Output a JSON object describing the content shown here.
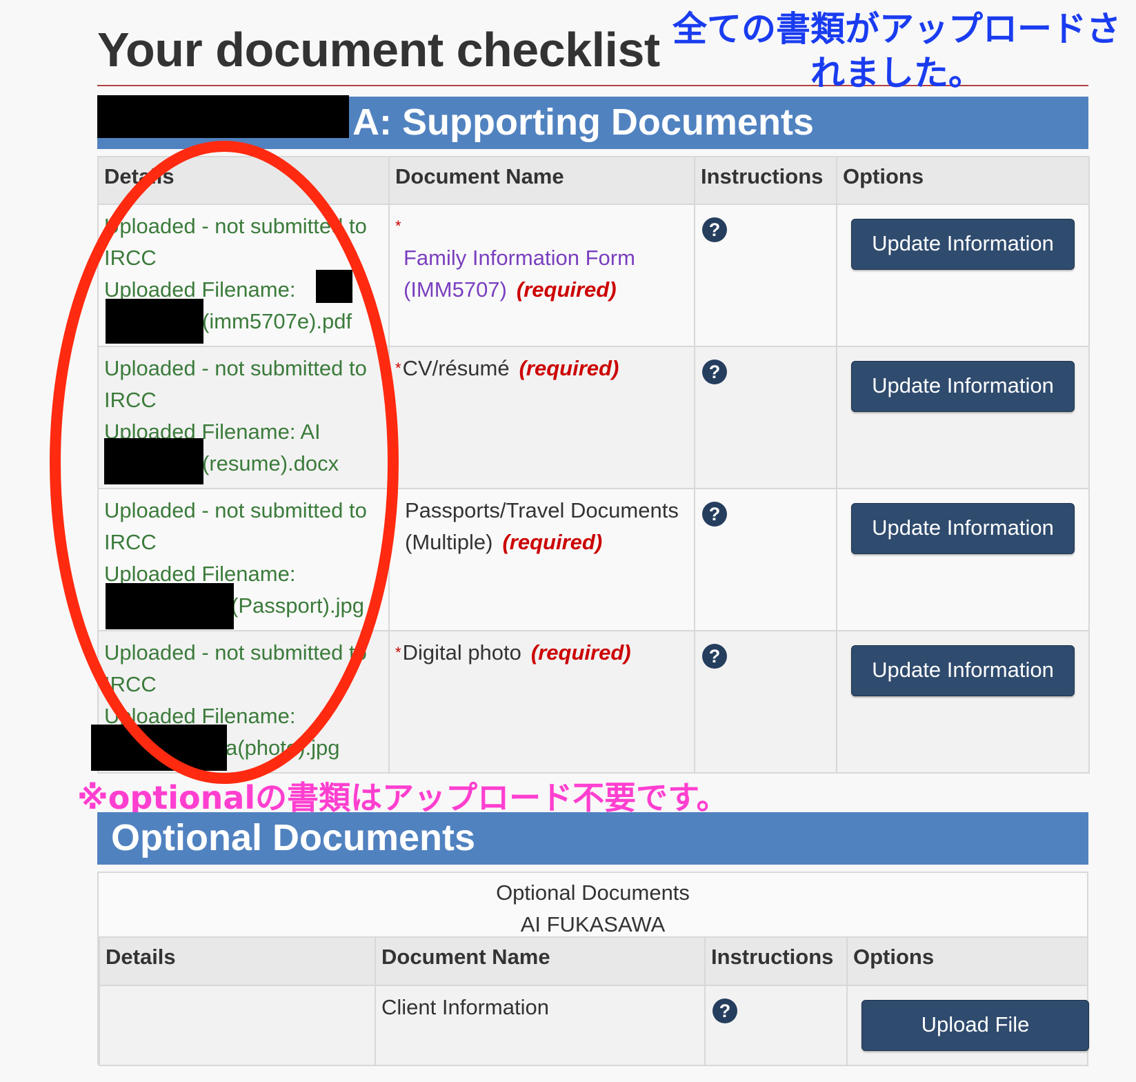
{
  "page": {
    "title": "Your document checklist"
  },
  "annotations": {
    "all_uploaded_note": "全ての書類がアップロードされました。",
    "optional_note": "※optionalの書類はアップロード不要です。"
  },
  "supporting": {
    "header_suffix": "A: Supporting Documents",
    "columns": {
      "details": "Details",
      "document_name": "Document Name",
      "instructions": "Instructions",
      "options": "Options"
    },
    "rows": [
      {
        "status": "Uploaded - not submitted to IRCC",
        "filename_label": "Uploaded Filename:",
        "filename_visible": "(imm5707e).pdf",
        "asterisk": "*",
        "document_name": "Family Information Form (IMM5707)",
        "required": "(required)",
        "button": "Update Information"
      },
      {
        "status": "Uploaded - not submitted to IRCC",
        "filename_label": "Uploaded Filename:  AI",
        "filename_visible": "(resume).docx",
        "asterisk": "*",
        "document_name": "CV/résumé",
        "required": "(required)",
        "button": "Update Information"
      },
      {
        "status": "Uploaded - not submitted to IRCC",
        "filename_label": "Uploaded Filename:",
        "filename_visible": "(Passport).jpg",
        "asterisk": "",
        "document_name": "Passports/Travel Documents (Multiple)",
        "required": "(required)",
        "button": "Update Information"
      },
      {
        "status": "Uploaded - not submitted to IRCC",
        "filename_label": "Uploaded Filename:",
        "filename_visible": "a(photo).jpg",
        "asterisk": "*",
        "document_name": "Digital photo",
        "required": "(required)",
        "button": "Update Information"
      }
    ],
    "help_icon": "?"
  },
  "optional": {
    "header": "Optional Documents",
    "caption_line1": "Optional Documents",
    "caption_line2": "AI FUKASAWA",
    "columns": {
      "details": "Details",
      "document_name": "Document Name",
      "instructions": "Instructions",
      "options": "Options"
    },
    "rows": [
      {
        "details": "",
        "document_name": "Client Information",
        "button": "Upload File"
      }
    ],
    "help_icon": "?"
  },
  "colors": {
    "section_header_bg": "#5182c0",
    "button_bg": "#2f4b6e",
    "status_green": "#3b7b3b",
    "required_red": "#cc0000",
    "link_purple": "#7a3fbf",
    "annotation_blue": "#1a3cf0",
    "annotation_pink": "#ff3fd0",
    "annotation_circle": "#ff2a10"
  }
}
